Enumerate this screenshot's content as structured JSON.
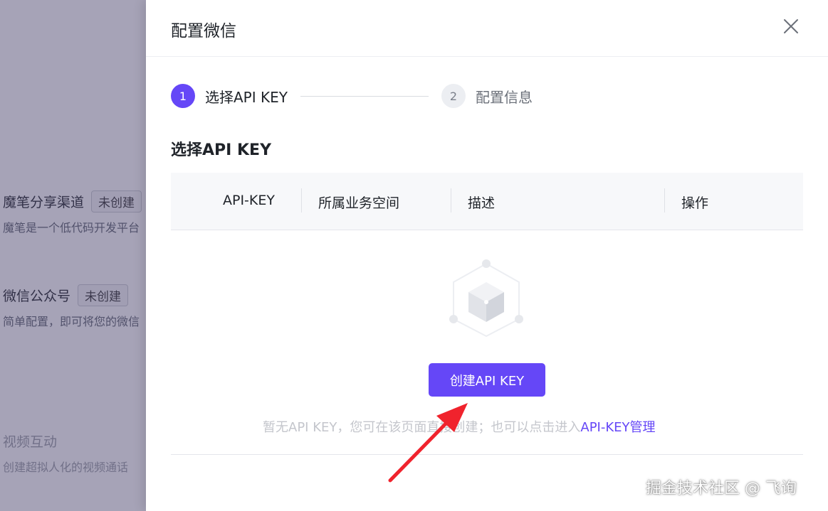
{
  "background": {
    "items": [
      {
        "title": "魔笔分享渠道",
        "badge": "未创建",
        "desc": "魔笔是一个低代码开发平台"
      },
      {
        "title": "微信公众号",
        "badge": "未创建",
        "desc": "简单配置，即可将您的微信"
      },
      {
        "title": "视频互动",
        "badge": "",
        "desc": "创建超拟人化的视频通话"
      }
    ]
  },
  "drawer": {
    "title": "配置微信",
    "steps": [
      {
        "number": "1",
        "label": "选择API KEY",
        "active": true
      },
      {
        "number": "2",
        "label": "配置信息",
        "active": false
      }
    ],
    "section_title": "选择API KEY",
    "table": {
      "columns": [
        "API-KEY",
        "所属业务空间",
        "描述",
        "操作"
      ]
    },
    "empty": {
      "create_button": "创建API KEY",
      "text": "暂无API KEY，您可在该页面直接创建；也可以点击进入",
      "link": "API-KEY管理"
    }
  },
  "watermark": "掘金技术社区 @ 飞询",
  "colors": {
    "accent": "#6547f7",
    "arrow": "#f0232d",
    "overlay": "rgba(70,62,105,0.48)"
  },
  "icons": {
    "close": "close-icon",
    "empty": "empty-box-icon",
    "arrow": "red-arrow-annotation"
  }
}
